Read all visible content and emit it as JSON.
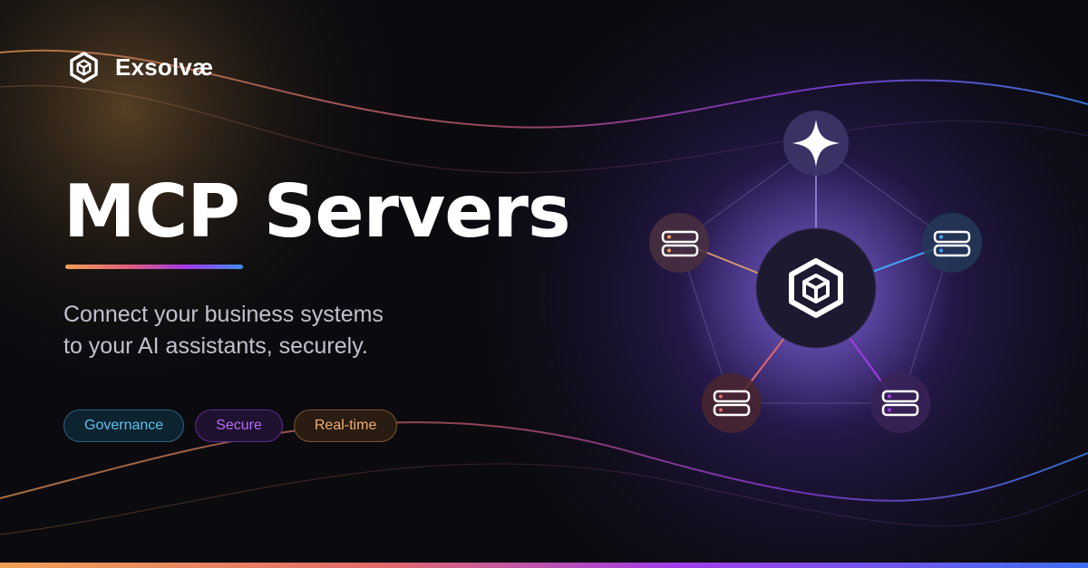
{
  "brand": {
    "name": "Exsolvæ",
    "logo_icon": "cube-logo-icon"
  },
  "hero": {
    "title": "MCP Servers",
    "subtitle_lines": [
      "Connect your business systems",
      "to your AI assistants, securely."
    ]
  },
  "tags": [
    "Governance",
    "Secure",
    "Real-time"
  ],
  "diagram": {
    "center_icon": "cube-logo-icon",
    "nodes": [
      {
        "id": "top",
        "icon": "sparkle-icon"
      },
      {
        "id": "left",
        "icon": "server-icon"
      },
      {
        "id": "right",
        "icon": "server-icon"
      },
      {
        "id": "bottom-left",
        "icon": "server-icon"
      },
      {
        "id": "bottom-right",
        "icon": "server-icon"
      }
    ]
  },
  "colors": {
    "background": "#0b0a0f",
    "orange": "#f0a055",
    "purple": "#a23ae6",
    "blue": "#3f8ff2",
    "tag_governance": "#5fc1ea",
    "tag_secure": "#b56cf0",
    "tag_realtime": "#f0ad72"
  }
}
